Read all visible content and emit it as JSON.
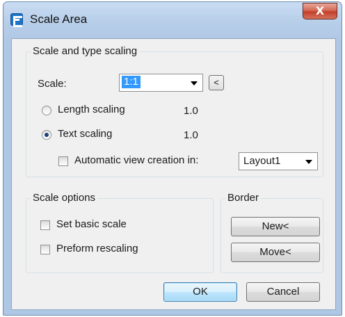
{
  "window": {
    "title": "Scale Area",
    "close_glyph": "X"
  },
  "scale_group": {
    "legend": "Scale and type scaling",
    "scale_label": "Scale:",
    "scale_value": "1:1",
    "pick_button": "<",
    "length_scaling": {
      "label": "Length scaling",
      "value": "1.0",
      "selected": false
    },
    "text_scaling": {
      "label": "Text scaling",
      "value": "1.0",
      "selected": true
    },
    "auto_view": {
      "label": "Automatic view creation in:",
      "checked": false
    },
    "layout_value": "Layout1"
  },
  "scale_options": {
    "legend": "Scale options",
    "set_basic_scale": {
      "label": "Set basic scale",
      "checked": false
    },
    "preform_rescaling": {
      "label": "Preform rescaling",
      "checked": false
    }
  },
  "border": {
    "legend": "Border",
    "new_button": "New<",
    "move_button": "Move<"
  },
  "footer": {
    "ok_button": "OK",
    "cancel_button": "Cancel"
  },
  "icons": {
    "app": "app-logo-icon",
    "dropdown": "chevron-down-icon",
    "close": "close-icon"
  },
  "colors": {
    "titlebar": "#b7cee9",
    "selection": "#3399ff",
    "close_button": "#c2402a",
    "default_button": "#bee6fd"
  }
}
